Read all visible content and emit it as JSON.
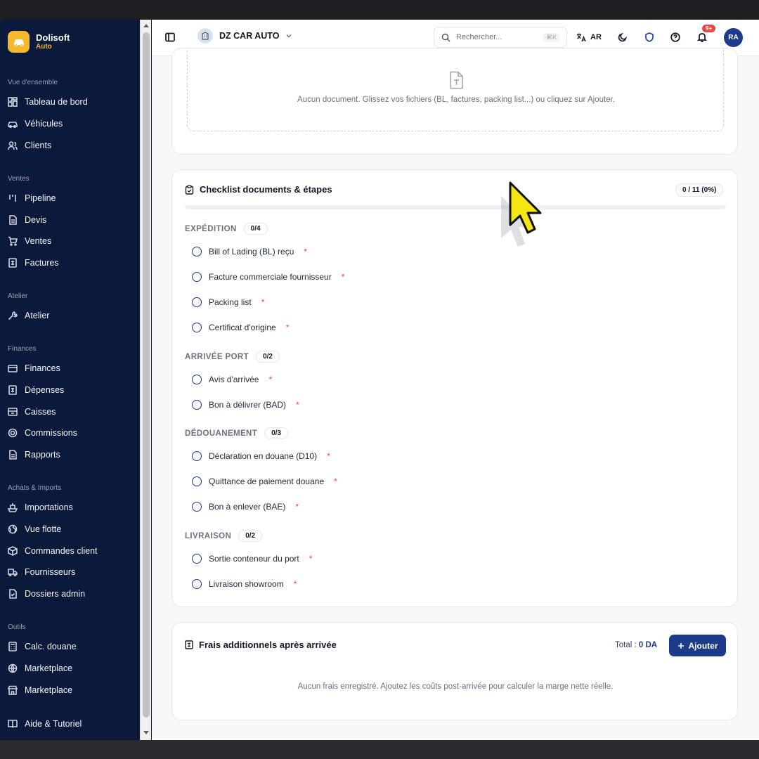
{
  "brand": {
    "name": "Dolisoft",
    "sub": "Auto"
  },
  "sidebar": {
    "sections": [
      {
        "label": "Vue d'ensemble",
        "items": [
          "Tableau de bord",
          "Véhicules",
          "Clients"
        ]
      },
      {
        "label": "Ventes",
        "items": [
          "Pipeline",
          "Devis",
          "Ventes",
          "Factures"
        ]
      },
      {
        "label": "Atelier",
        "items": [
          "Atelier"
        ]
      },
      {
        "label": "Finances",
        "items": [
          "Finances",
          "Dépenses",
          "Caisses",
          "Commissions",
          "Rapports"
        ]
      },
      {
        "label": "Achats & Imports",
        "items": [
          "Importations",
          "Vue flotte",
          "Commandes client",
          "Fournisseurs",
          "Dossiers admin"
        ]
      },
      {
        "label": "Outils",
        "items": [
          "Calc. douane",
          "Marketplace",
          "Marketplace"
        ]
      }
    ],
    "footer_item": "Aide & Tutoriel"
  },
  "topbar": {
    "company": "DZ CAR AUTO",
    "search_placeholder": "Rechercher...",
    "search_shortcut": "⌘K",
    "lang": "AR",
    "notif_badge": "9+",
    "user_initials": "RA"
  },
  "documents": {
    "empty_text": "Aucun document. Glissez vos fichiers (BL, factures, packing list...) ou cliquez sur Ajouter."
  },
  "checklist": {
    "title": "Checklist documents & étapes",
    "progress_label": "0 / 11 (0%)",
    "progress_fraction": 0,
    "groups": [
      {
        "label": "EXPÉDITION",
        "count": "0/4",
        "items": [
          "Bill of Lading (BL) reçu",
          "Facture commerciale fournisseur",
          "Packing list",
          "Certificat d'origine"
        ]
      },
      {
        "label": "ARRIVÉE PORT",
        "count": "0/2",
        "items": [
          "Avis d'arrivée",
          "Bon à délivrer (BAD)"
        ]
      },
      {
        "label": "DÉDOUANEMENT",
        "count": "0/3",
        "items": [
          "Déclaration en douane (D10)",
          "Quittance de paiement douane",
          "Bon à enlever (BAE)"
        ]
      },
      {
        "label": "LIVRAISON",
        "count": "0/2",
        "items": [
          "Sortie conteneur du port",
          "Livraison showroom"
        ]
      }
    ],
    "required_mark": "*"
  },
  "frais": {
    "title": "Frais additionnels après arrivée",
    "total_label": "Total :",
    "total_value": "0 DA",
    "add_label": "Ajouter",
    "empty_text": "Aucun frais enregistré. Ajoutez les coûts post-arrivée pour calculer la marge nette réelle."
  },
  "colors": {
    "sidebar": "#0b1a3a",
    "accent": "#1e3a8a",
    "brand": "#f5b82e",
    "required": "#ef4444"
  }
}
